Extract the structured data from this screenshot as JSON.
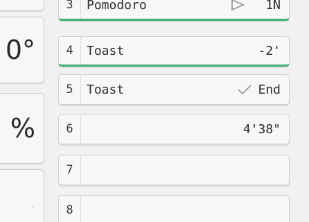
{
  "stats": {
    "top_value": "",
    "degrees_value": "0°",
    "percent_value": "%",
    "faint_value": "."
  },
  "tasks": [
    {
      "number": "3",
      "name": "Pomodoro",
      "right": "1N",
      "icon": "play-icon",
      "active": true
    },
    {
      "number": "4",
      "name": "Toast",
      "right": "-2'",
      "icon": "",
      "active": true
    },
    {
      "number": "5",
      "name": "Toast",
      "right": "End",
      "icon": "check-icon",
      "active": false
    },
    {
      "number": "6",
      "name": "",
      "right": "4'38\"",
      "icon": "",
      "active": false
    },
    {
      "number": "7",
      "name": "",
      "right": "",
      "icon": "",
      "active": false
    },
    {
      "number": "8",
      "name": "",
      "right": "",
      "icon": "",
      "active": false
    }
  ],
  "colors": {
    "accent": "#3bb26f",
    "background": "#f1f1f1",
    "card": "#f7f7f7"
  }
}
